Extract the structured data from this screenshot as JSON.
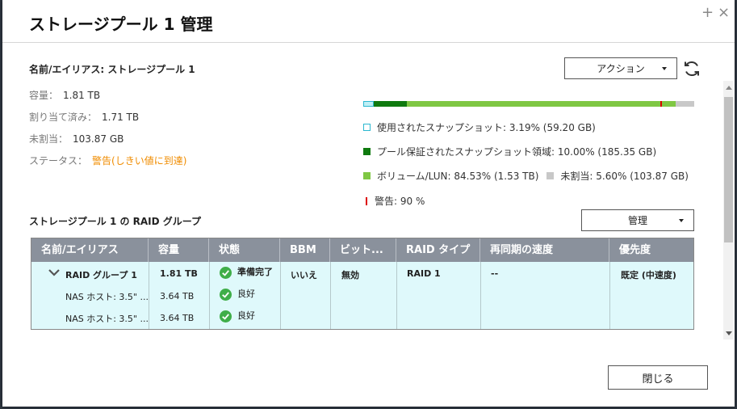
{
  "dialog": {
    "title": "ストレージプール 1 管理",
    "icons": [
      "plus-icon",
      "close-icon"
    ],
    "plus_glyph": "+",
    "close_glyph": "×"
  },
  "pool": {
    "name": "名前/エイリアス: ストレージプール 1",
    "info": [
      {
        "label": "容量：",
        "value": "1.81 TB"
      },
      {
        "label": "割り当て済み：",
        "value": "1.71 TB"
      },
      {
        "label": "未割当：",
        "value": "103.87 GB"
      }
    ],
    "status_label": "ステータス：",
    "status_value": "警告(しきい値に到達)",
    "status_color": "#f08c00"
  },
  "actions": {
    "action_button": "アクション",
    "manage_button": "管理",
    "close_button": "閉じる",
    "refresh_icon": "refresh-icon"
  },
  "usage": {
    "snapshot_percent": 3.19,
    "guaranteed_percent": 10.0,
    "volume_percent": 84.53,
    "unallocated_percent": 5.6,
    "warning_threshold_percent": 90,
    "colors": {
      "snapshot": "#bfeff5",
      "guaranteed": "#0f7a0f",
      "volume": "#7fc743",
      "unallocated": "#c8c8c8",
      "warning": "#dd0000"
    },
    "legend": {
      "snapshot": "使用されたスナップショット: 3.19% (59.20 GB)",
      "guaranteed": "プール保証されたスナップショット領域: 10.00% (185.35 GB)",
      "volume": "ボリューム/LUN: 84.53% (1.53 TB)",
      "unallocated": "未割当: 5.60% (103.87 GB)",
      "warning": "警告: 90 %"
    }
  },
  "raid": {
    "section_title": "ストレージプール 1 の RAID グループ",
    "headers": [
      "名前/エイリアス",
      "容量",
      "状態",
      "BBM",
      "ビット...",
      "RAID タイプ",
      "再同期の速度",
      "優先度"
    ],
    "group": {
      "name": "RAID グループ 1",
      "capacity": "1.81 TB",
      "status": "準備完了",
      "bbm": "いいえ",
      "bitmap": "無効",
      "raid_type": "RAID 1",
      "resync": "--",
      "priority": "既定 (中速度)"
    },
    "disks": [
      {
        "name": "NAS ホスト: 3.5\" ...",
        "capacity": "3.64 TB",
        "status": "良好"
      },
      {
        "name": "NAS ホスト: 3.5\" ...",
        "capacity": "3.64 TB",
        "status": "良好"
      }
    ]
  }
}
